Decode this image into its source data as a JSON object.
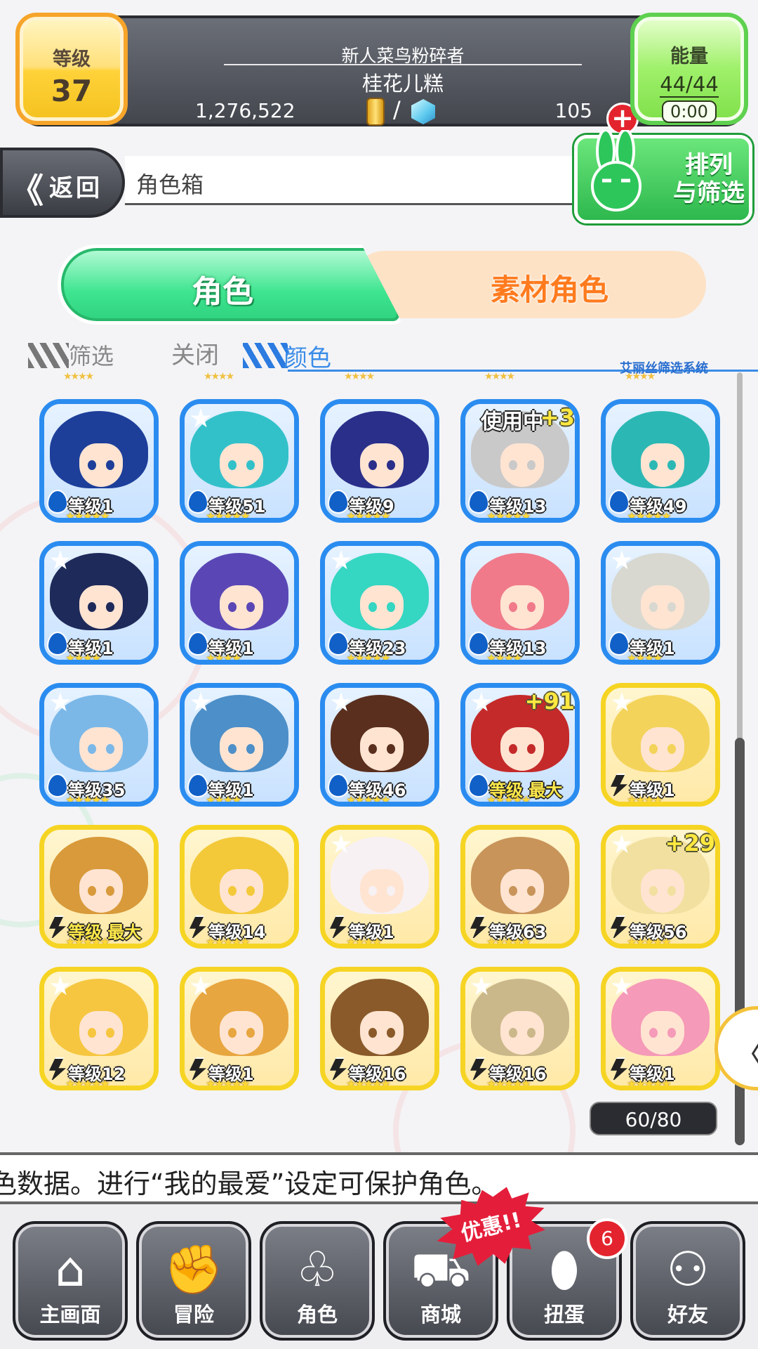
{
  "player": {
    "level_label": "等级",
    "level": "37",
    "title": "新人菜鸟粉碎者",
    "name": "桂花儿糕",
    "coins": "1,276,522",
    "slash": "/",
    "gems": "105",
    "add_symbol": "+",
    "energy_label": "能量",
    "energy": "44/44",
    "energy_timer": "0:00"
  },
  "header": {
    "back_chevron": "《",
    "back_label": "返回",
    "page_title": "角色箱",
    "sort_filter_label_1": "排列",
    "sort_filter_label_2": "与筛选"
  },
  "tabs": {
    "character": "角色",
    "material": "素材角色"
  },
  "filter": {
    "label": "筛选",
    "off": "关闭",
    "color": "颜色",
    "system": "艾丽丝筛选系统"
  },
  "characters": [
    {
      "frame": "blue",
      "level": "等级1",
      "stars": "★★★★★",
      "has_star": false,
      "hair": "#1d3f9a"
    },
    {
      "frame": "blue",
      "level": "等级51",
      "stars": "★★★★★",
      "has_star": true,
      "hair": "#33c1c9"
    },
    {
      "frame": "blue",
      "level": "等级9",
      "stars": "★★★★★",
      "has_star": false,
      "hair": "#2a2f8a"
    },
    {
      "frame": "blue",
      "level": "等级13",
      "stars": "★★★★★",
      "has_star": false,
      "hair": "#c9c9c9",
      "in_use": "使用中",
      "plus": "+3"
    },
    {
      "frame": "blue",
      "level": "等级49",
      "stars": "★★★★★",
      "has_star": false,
      "hair": "#2bb8b4"
    },
    {
      "frame": "blue",
      "level": "等级1",
      "stars": "★★★★",
      "has_star": true,
      "hair": "#1e2a5a"
    },
    {
      "frame": "blue",
      "level": "等级1",
      "stars": "★★★★",
      "has_star": false,
      "hair": "#5a47b5"
    },
    {
      "frame": "blue",
      "level": "等级23",
      "stars": "★★★★★",
      "has_star": true,
      "hair": "#35d6c2"
    },
    {
      "frame": "blue",
      "level": "等级13",
      "stars": "★★★★",
      "has_star": false,
      "hair": "#f07a8a"
    },
    {
      "frame": "blue",
      "level": "等级1",
      "stars": "★★★★",
      "has_star": true,
      "hair": "#d8d8d0"
    },
    {
      "frame": "blue",
      "level": "等级35",
      "stars": "★★★★★",
      "has_star": true,
      "hair": "#7bb8e8"
    },
    {
      "frame": "blue",
      "level": "等级1",
      "stars": "★★★★",
      "has_star": true,
      "hair": "#4d8fc8"
    },
    {
      "frame": "blue",
      "level": "等级46",
      "stars": "★★★★★",
      "has_star": true,
      "hair": "#5a2f1e"
    },
    {
      "frame": "blue",
      "level": "等级 最大",
      "stars": "★★★★★",
      "has_star": true,
      "hair": "#c42a2a",
      "plus": "+91",
      "max": true
    },
    {
      "frame": "yellow",
      "level": "等级1",
      "stars": "★★★★",
      "has_star": true,
      "hair": "#f3d35a"
    },
    {
      "frame": "yellow",
      "level": "等级 最大",
      "stars": "★★★★★",
      "has_star": false,
      "hair": "#d89a3a",
      "max": true
    },
    {
      "frame": "yellow",
      "level": "等级14",
      "stars": "★★★★★",
      "has_star": false,
      "hair": "#f3c93a"
    },
    {
      "frame": "yellow",
      "level": "等级1",
      "stars": "★★★★",
      "has_star": true,
      "hair": "#f7f1f4"
    },
    {
      "frame": "yellow",
      "level": "等级63",
      "stars": "★★★★★",
      "has_star": false,
      "hair": "#c8945a"
    },
    {
      "frame": "yellow",
      "level": "等级56",
      "stars": "★★★★★",
      "has_star": true,
      "hair": "#f1e0a0",
      "plus": "+29"
    },
    {
      "frame": "yellow",
      "level": "等级12",
      "stars": "★★★★★",
      "has_star": true,
      "hair": "#f6c640"
    },
    {
      "frame": "yellow",
      "level": "等级1",
      "stars": "★★★★★",
      "has_star": true,
      "hair": "#e8a640"
    },
    {
      "frame": "yellow",
      "level": "等级16",
      "stars": "★★★★★",
      "has_star": false,
      "hair": "#8a5a2a"
    },
    {
      "frame": "yellow",
      "level": "等级16",
      "stars": "★★★★★",
      "has_star": true,
      "hair": "#cbb88a"
    },
    {
      "frame": "yellow",
      "level": "等级1",
      "stars": "★★★★★",
      "has_star": true,
      "hair": "#f59ab8"
    }
  ],
  "counter": "60/80",
  "side_handle": "〈",
  "hint": "色数据。进行“我的最爱”设定可保护角色。",
  "nav": [
    {
      "label": "主画面",
      "icon": "home-icon",
      "glyph": "⌂"
    },
    {
      "label": "冒险",
      "icon": "handshake-icon",
      "glyph": "✊"
    },
    {
      "label": "角色",
      "icon": "bunny-icon",
      "glyph": "♧"
    },
    {
      "label": "商城",
      "icon": "cart-icon",
      "glyph": "⛟"
    },
    {
      "label": "扭蛋",
      "icon": "egg-icon",
      "glyph": "⬮"
    },
    {
      "label": "好友",
      "icon": "friends-icon",
      "glyph": "⚇"
    }
  ],
  "deal_badge": "优惠!!",
  "gacha_notifications": "6",
  "colors": {
    "blue_frame": "#2b8cf0",
    "yellow_frame": "#f6d423",
    "tab_active": "#3fe590",
    "tab_inactive": "#fde2c6",
    "accent_red": "#e3242e"
  }
}
